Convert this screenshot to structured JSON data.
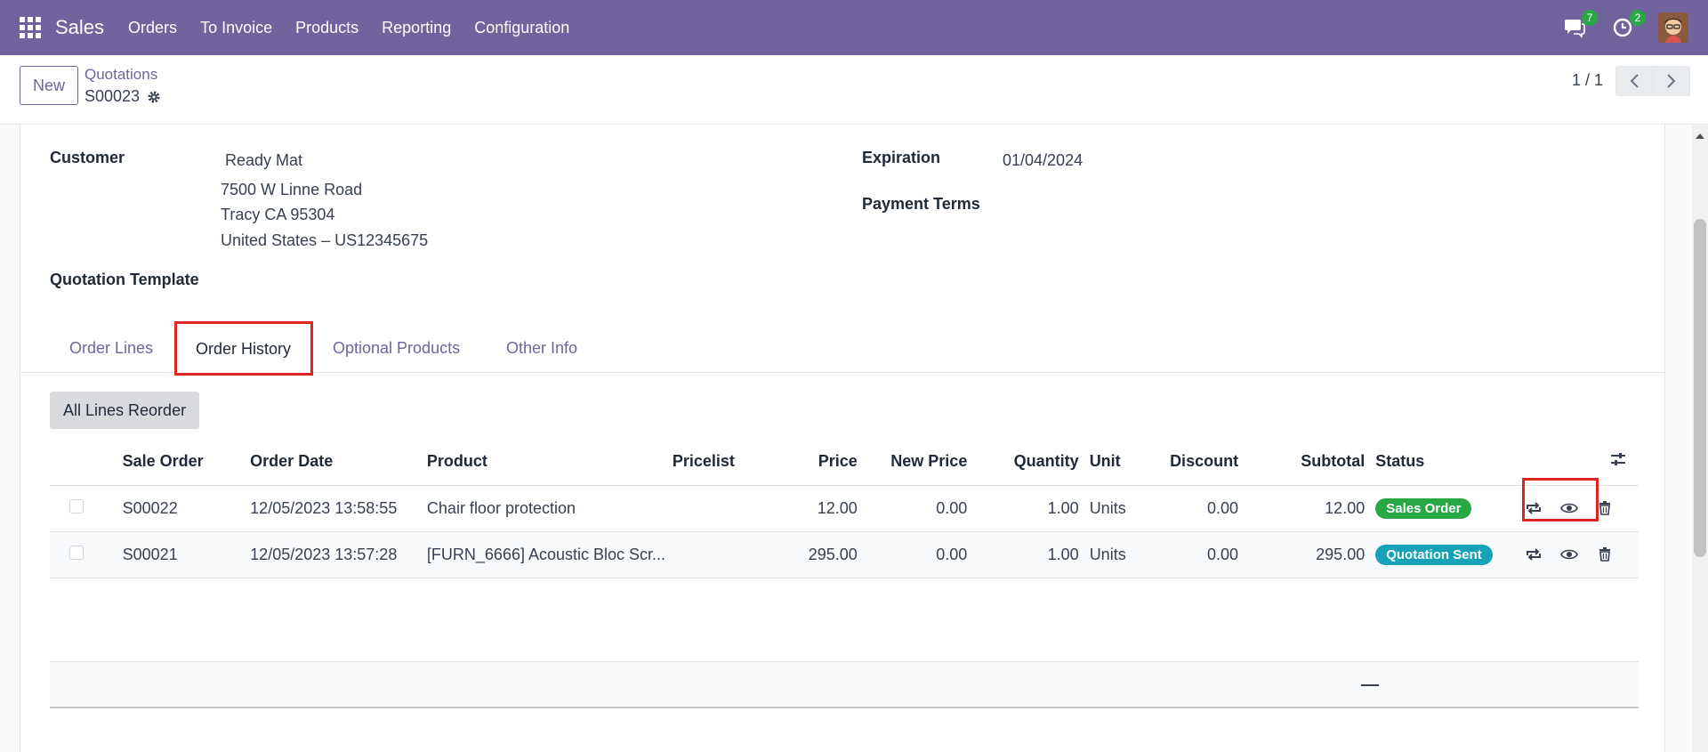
{
  "navbar": {
    "brand": "Sales",
    "menu": [
      "Orders",
      "To Invoice",
      "Products",
      "Reporting",
      "Configuration"
    ],
    "messages_count": "7",
    "activities_count": "2",
    "icons": [
      "apps-icon",
      "chat-icon",
      "clock-icon",
      "user-avatar"
    ]
  },
  "control_panel": {
    "new_label": "New",
    "breadcrumb_parent": "Quotations",
    "record_name": "S00023",
    "pager_value": "1 / 1"
  },
  "form": {
    "customer_label": "Customer",
    "customer_name": "Ready Mat",
    "customer_address_1": "7500 W Linne Road",
    "customer_address_2": "Tracy CA 95304",
    "customer_address_3": "United States – US12345675",
    "expiration_label": "Expiration",
    "expiration_value": "01/04/2024",
    "payment_terms_label": "Payment Terms",
    "quotation_template_label": "Quotation Template"
  },
  "tabs": [
    "Order Lines",
    "Order History",
    "Optional Products",
    "Other Info"
  ],
  "active_tab": "Order History",
  "order_history": {
    "reorder_all_label": "All Lines Reorder",
    "columns": [
      "Sale Order",
      "Order Date",
      "Product",
      "Pricelist",
      "Price",
      "New Price",
      "Quantity",
      "Unit",
      "Discount",
      "Subtotal",
      "Status"
    ],
    "rows": [
      {
        "sale_order": "S00022",
        "order_date": "12/05/2023 13:58:55",
        "product": "Chair floor protection",
        "pricelist": "",
        "price": "12.00",
        "new_price": "0.00",
        "quantity": "1.00",
        "unit": "Units",
        "discount": "0.00",
        "subtotal": "12.00",
        "status": "Sales Order",
        "status_color": "#28a745"
      },
      {
        "sale_order": "S00021",
        "order_date": "12/05/2023 13:57:28",
        "product": "[FURN_6666] Acoustic Bloc Scr...",
        "pricelist": "",
        "price": "295.00",
        "new_price": "0.00",
        "quantity": "1.00",
        "unit": "Units",
        "discount": "0.00",
        "subtotal": "295.00",
        "status": "Quotation Sent",
        "status_color": "#17a2b8"
      }
    ],
    "footer_dash": "—"
  },
  "colors": {
    "brand": "#71639e",
    "highlight": "#e02424"
  }
}
